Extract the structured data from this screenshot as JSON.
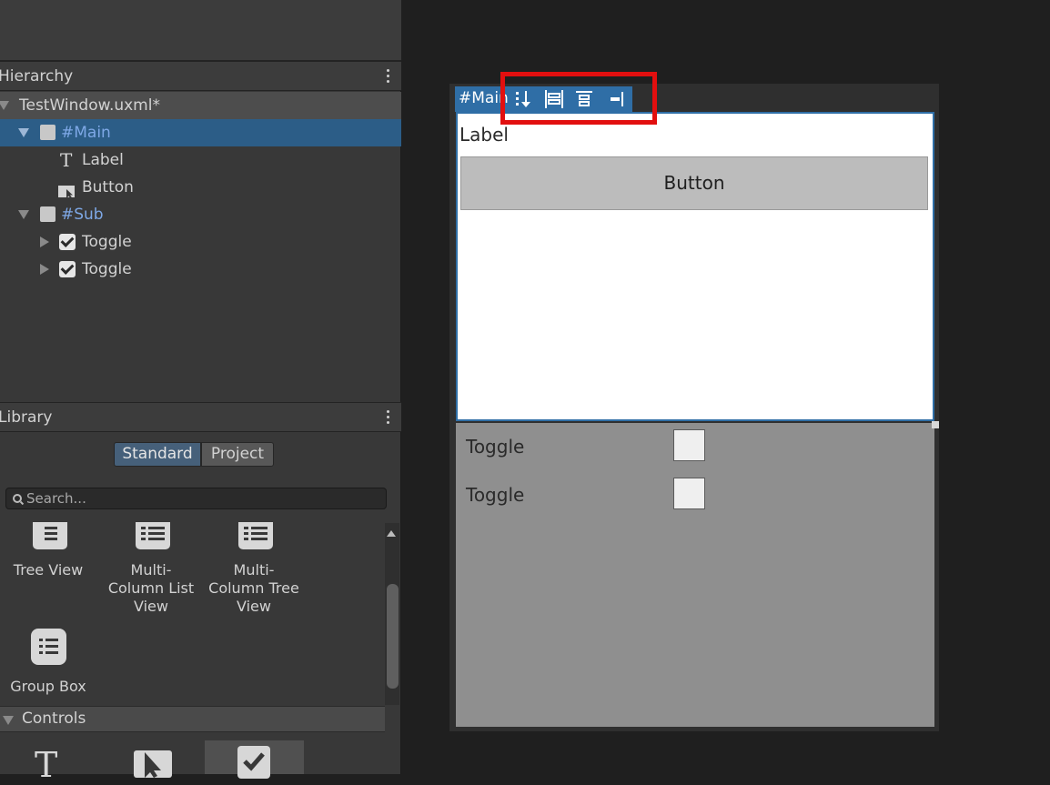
{
  "hierarchy": {
    "title": "Hierarchy",
    "document": "TestWindow.uxml*",
    "items": [
      {
        "label": "#Main"
      },
      {
        "label": "Label"
      },
      {
        "label": "Button"
      },
      {
        "label": "#Sub"
      },
      {
        "label": "Toggle"
      },
      {
        "label": "Toggle"
      }
    ]
  },
  "library": {
    "title": "Library",
    "tabs": [
      {
        "label": "Standard",
        "selected": true
      },
      {
        "label": "Project",
        "selected": false
      }
    ],
    "search_placeholder": "Search...",
    "items": [
      {
        "label": "Tree View",
        "icon": "tree-view-icon"
      },
      {
        "label": "Multi-\nColumn List\nView",
        "icon": "multi-column-list-view-icon"
      },
      {
        "label": "Multi-\nColumn Tree\nView",
        "icon": "multi-column-tree-view-icon"
      },
      {
        "label": "Group Box",
        "icon": "group-box-icon"
      }
    ],
    "section": "Controls"
  },
  "canvas": {
    "main_tab": "#Main",
    "label_text": "Label",
    "button_text": "Button",
    "toggles": [
      {
        "label": "Toggle"
      },
      {
        "label": "Toggle"
      }
    ]
  },
  "colors": {
    "selection": "#2c5d87",
    "accent": "#2f6ea6",
    "highlight": "#e20f0f",
    "link": "#7ea8e6"
  }
}
